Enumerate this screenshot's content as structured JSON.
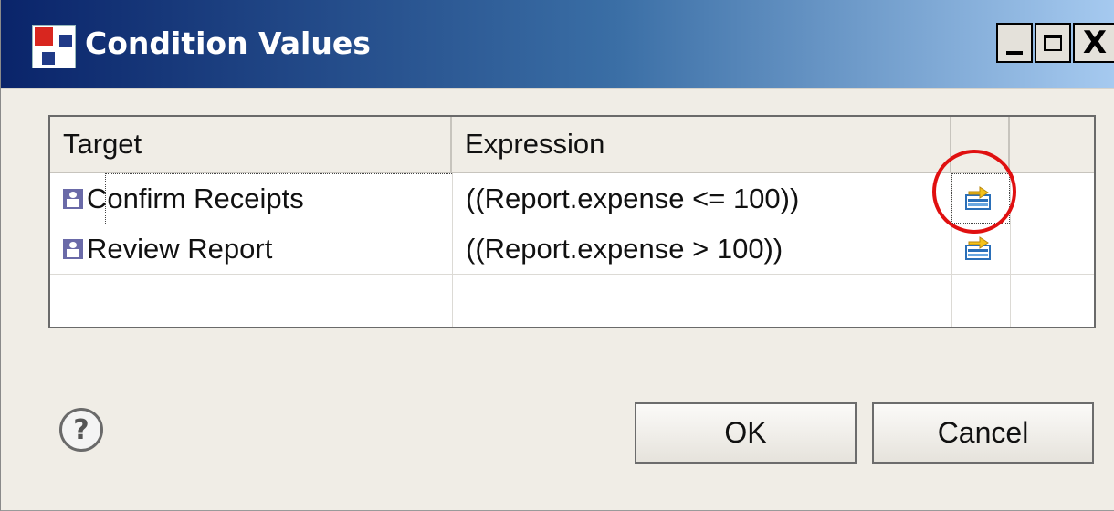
{
  "window": {
    "title": "Condition Values",
    "controls": {
      "minimize": "_",
      "maximize": "□",
      "close": "X"
    }
  },
  "table": {
    "columns": [
      "Target",
      "Expression",
      "",
      ""
    ],
    "rows": [
      {
        "target": "Confirm Receipts",
        "expression": "((Report.expense <= 100))",
        "icon": "edit-expression-icon"
      },
      {
        "target": "Review Report",
        "expression": "((Report.expense > 100))",
        "icon": "edit-expression-icon"
      }
    ]
  },
  "buttons": {
    "help": "?",
    "ok": "OK",
    "cancel": "Cancel"
  },
  "colors": {
    "titlebar_start": "#0a246a",
    "titlebar_end": "#a6caf0",
    "annotation": "#e01010",
    "dialog_bg": "#f0ede6"
  }
}
